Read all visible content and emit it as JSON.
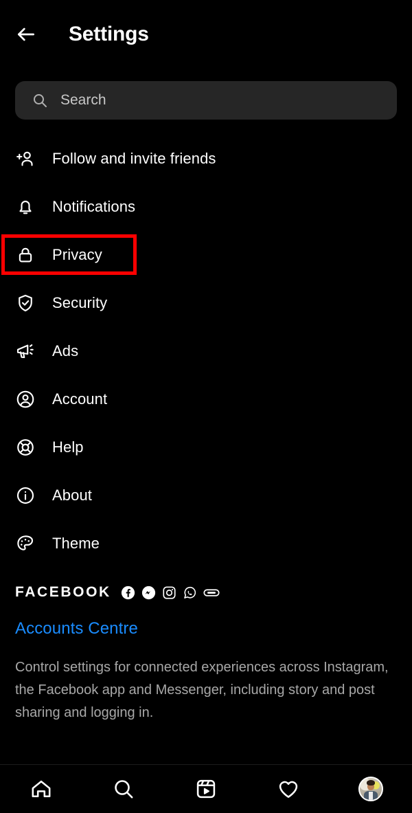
{
  "header": {
    "back_icon": "arrow-left-icon",
    "title": "Settings"
  },
  "search": {
    "icon": "search-icon",
    "placeholder": "Search",
    "value": ""
  },
  "menu": {
    "items": [
      {
        "label": "Follow and invite friends",
        "icon": "person-add-icon",
        "highlighted": false
      },
      {
        "label": "Notifications",
        "icon": "bell-icon",
        "highlighted": false
      },
      {
        "label": "Privacy",
        "icon": "lock-icon",
        "highlighted": true
      },
      {
        "label": "Security",
        "icon": "shield-check-icon",
        "highlighted": false
      },
      {
        "label": "Ads",
        "icon": "megaphone-icon",
        "highlighted": false
      },
      {
        "label": "Account",
        "icon": "user-circle-icon",
        "highlighted": false
      },
      {
        "label": "Help",
        "icon": "lifebuoy-icon",
        "highlighted": false
      },
      {
        "label": "About",
        "icon": "info-circle-icon",
        "highlighted": false
      },
      {
        "label": "Theme",
        "icon": "palette-icon",
        "highlighted": false
      }
    ]
  },
  "annotation": {
    "highlight_color": "#ff0000",
    "target": "Privacy"
  },
  "facebook_section": {
    "heading": "FACEBOOK",
    "brand_icons": [
      "facebook-icon",
      "messenger-icon",
      "instagram-icon",
      "whatsapp-icon",
      "oculus-icon"
    ],
    "link_label": "Accounts Centre",
    "link_color": "#1a8cff",
    "description": "Control settings for connected experiences across Instagram, the Facebook app and Messenger, including story and post sharing and logging in."
  },
  "bottom_nav": {
    "items": [
      {
        "icon": "home-icon",
        "label": "Home"
      },
      {
        "icon": "search-icon",
        "label": "Search"
      },
      {
        "icon": "reels-icon",
        "label": "Reels"
      },
      {
        "icon": "heart-icon",
        "label": "Activity"
      },
      {
        "icon": "profile-avatar",
        "label": "Profile"
      }
    ]
  }
}
